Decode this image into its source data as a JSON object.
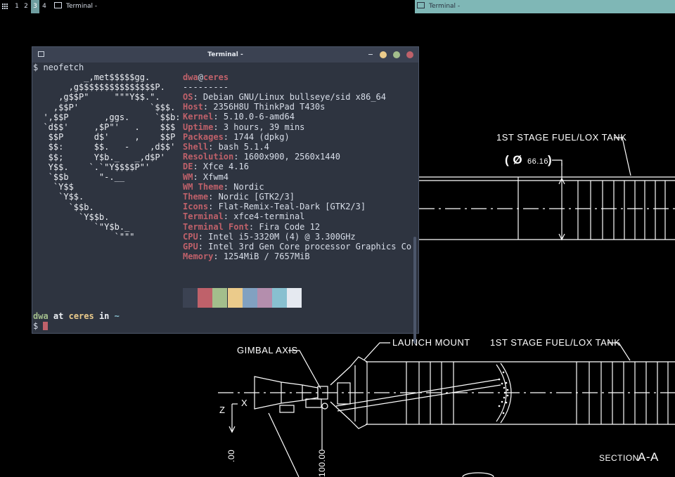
{
  "panel": {
    "workspaces": [
      "1",
      "2",
      "3",
      "4"
    ],
    "active_workspace": "3",
    "task_left": "Terminal -",
    "task_right": "Terminal -"
  },
  "cad": {
    "label_tank_top": "1ST STAGE FUEL/LOX TANK",
    "label_diameter_symbol": "( Ø",
    "label_diameter_value": "66.16",
    "label_diameter_close": ")",
    "label_gimbal": "GIMBAL AXIS",
    "label_launch_mount": "LAUNCH MOUNT",
    "label_tank_bottom": "1ST STAGE FUEL/LOX TANK",
    "label_axis_z": "Z",
    "label_axis_x": "X",
    "label_dim_00": ".00",
    "label_dim_100": "100.00",
    "label_section_prefix": "SECTION",
    "label_section": "A-A"
  },
  "terminal": {
    "title": "Terminal -",
    "command": "$ neofetch",
    "ascii_art": [
      "          _,met$$$$$gg.",
      "       ,g$$$$$$$$$$$$$$$P.",
      "     ,g$$P\"     \"\"\"Y$$.\".",
      "    ,$$P'              `$$$.",
      "  ',$$P       ,ggs.     `$$b:",
      "  `d$$'     ,$P\"'   .    $$$",
      "   $$P      d$'     ,    $$P",
      "   $$:      $$.   -    ,d$$'",
      "   $$;      Y$b._   _,d$P'",
      "   Y$$.    `.`\"Y$$$$P\"'",
      "   `$$b      \"-.__",
      "    `Y$$",
      "     `Y$$.",
      "       `$$b.",
      "         `Y$$b.",
      "            `\"Y$b._",
      "                `\"\"\""
    ],
    "user": "dwa",
    "at": "@",
    "host": "ceres",
    "separator": "---------",
    "info": [
      {
        "label": "OS",
        "value": "Debian GNU/Linux bullseye/sid x86_64"
      },
      {
        "label": "Host",
        "value": "2356H8U ThinkPad T430s"
      },
      {
        "label": "Kernel",
        "value": "5.10.0-6-amd64"
      },
      {
        "label": "Uptime",
        "value": "3 hours, 39 mins"
      },
      {
        "label": "Packages",
        "value": "1744 (dpkg)"
      },
      {
        "label": "Shell",
        "value": "bash 5.1.4"
      },
      {
        "label": "Resolution",
        "value": "1600x900, 2560x1440"
      },
      {
        "label": "DE",
        "value": "Xfce 4.16"
      },
      {
        "label": "WM",
        "value": "Xfwm4"
      },
      {
        "label": "WM Theme",
        "value": "Nordic"
      },
      {
        "label": "Theme",
        "value": "Nordic [GTK2/3]"
      },
      {
        "label": "Icons",
        "value": "Flat-Remix-Teal-Dark [GTK2/3]"
      },
      {
        "label": "Terminal",
        "value": "xfce4-terminal"
      },
      {
        "label": "Terminal Font",
        "value": "Fira Code 12"
      },
      {
        "label": "CPU",
        "value": "Intel i5-3320M (4) @ 3.300GHz"
      },
      {
        "label": "GPU",
        "value": "Intel 3rd Gen Core processor Graphics Co"
      },
      {
        "label": "Memory",
        "value": "1254MiB / 7657MiB"
      }
    ],
    "palette": [
      "#3b4252",
      "#bf616a",
      "#a3be8c",
      "#ebcb8b",
      "#81a1c1",
      "#b48ead",
      "#88c0d0",
      "#e5e9f0"
    ],
    "prompt_user": "dwa",
    "prompt_at": " at ",
    "prompt_host": "ceres",
    "prompt_in": " in ",
    "prompt_dir": "~",
    "prompt_symbol": "$ "
  }
}
